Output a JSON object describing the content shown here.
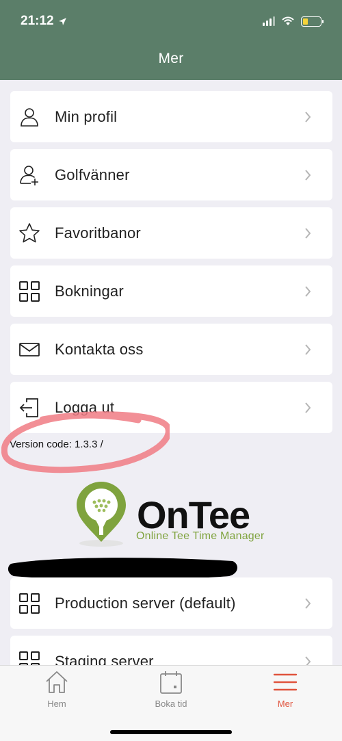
{
  "status_bar": {
    "time": "21:12"
  },
  "header": {
    "title": "Mer"
  },
  "menu": {
    "items": [
      {
        "label": "Min profil",
        "icon": "user-icon"
      },
      {
        "label": "Golfvänner",
        "icon": "add-friend-icon"
      },
      {
        "label": "Favoritbanor",
        "icon": "star-icon"
      },
      {
        "label": "Bokningar",
        "icon": "grid-icon"
      },
      {
        "label": "Kontakta oss",
        "icon": "mail-icon"
      },
      {
        "label": "Logga ut",
        "icon": "logout-icon"
      }
    ]
  },
  "version_text": "Version code: 1.3.3 /",
  "logo": {
    "name": "OnTee",
    "tagline": "Online Tee Time Manager"
  },
  "servers": {
    "items": [
      {
        "label": "Production server (default)",
        "icon": "grid-icon"
      },
      {
        "label": "Staging server",
        "icon": "grid-icon"
      }
    ]
  },
  "tabbar": {
    "tabs": [
      {
        "label": "Hem",
        "icon": "home-icon"
      },
      {
        "label": "Boka tid",
        "icon": "calendar-icon"
      },
      {
        "label": "Mer",
        "icon": "menu-icon",
        "active": true
      }
    ]
  },
  "colors": {
    "header": "#5b7e69",
    "accent": "#e0533d",
    "brand_green": "#7fa33e",
    "annotation": "#f07b84"
  }
}
